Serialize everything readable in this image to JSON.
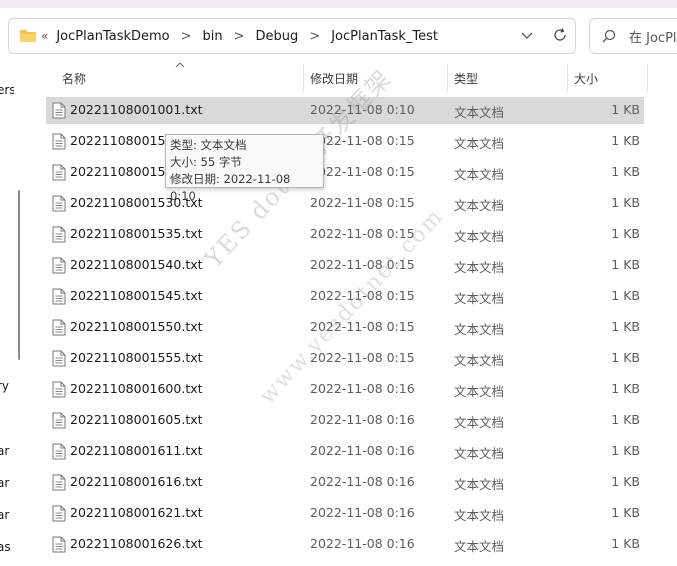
{
  "address": {
    "overflow_chevron": "«",
    "crumbs": [
      "JocPlanTaskDemo",
      "bin",
      "Debug",
      "JocPlanTask_Test"
    ],
    "separator": ">"
  },
  "search": {
    "placeholder": "在 JocPlan"
  },
  "navpane": {
    "fragments": [
      "ers",
      "ry",
      "ar",
      "ar",
      "ar",
      "as"
    ]
  },
  "columns": {
    "name": "名称",
    "date": "修改日期",
    "type": "类型",
    "size": "大小"
  },
  "files": [
    {
      "name": "20221108001001.txt",
      "date": "2022-11-08 0:10",
      "type": "文本文档",
      "size": "1 KB"
    },
    {
      "name": "20221108001520.txt",
      "date": "2022-11-08 0:15",
      "type": "文本文档",
      "size": "1 KB"
    },
    {
      "name": "20221108001525.txt",
      "date": "2022-11-08 0:15",
      "type": "文本文档",
      "size": "1 KB"
    },
    {
      "name": "20221108001530.txt",
      "date": "2022-11-08 0:15",
      "type": "文本文档",
      "size": "1 KB"
    },
    {
      "name": "20221108001535.txt",
      "date": "2022-11-08 0:15",
      "type": "文本文档",
      "size": "1 KB"
    },
    {
      "name": "20221108001540.txt",
      "date": "2022-11-08 0:15",
      "type": "文本文档",
      "size": "1 KB"
    },
    {
      "name": "20221108001545.txt",
      "date": "2022-11-08 0:15",
      "type": "文本文档",
      "size": "1 KB"
    },
    {
      "name": "20221108001550.txt",
      "date": "2022-11-08 0:15",
      "type": "文本文档",
      "size": "1 KB"
    },
    {
      "name": "20221108001555.txt",
      "date": "2022-11-08 0:15",
      "type": "文本文档",
      "size": "1 KB"
    },
    {
      "name": "20221108001600.txt",
      "date": "2022-11-08 0:16",
      "type": "文本文档",
      "size": "1 KB"
    },
    {
      "name": "20221108001605.txt",
      "date": "2022-11-08 0:16",
      "type": "文本文档",
      "size": "1 KB"
    },
    {
      "name": "20221108001611.txt",
      "date": "2022-11-08 0:16",
      "type": "文本文档",
      "size": "1 KB"
    },
    {
      "name": "20221108001616.txt",
      "date": "2022-11-08 0:16",
      "type": "文本文档",
      "size": "1 KB"
    },
    {
      "name": "20221108001621.txt",
      "date": "2022-11-08 0:16",
      "type": "文本文档",
      "size": "1 KB"
    },
    {
      "name": "20221108001626.txt",
      "date": "2022-11-08 0:16",
      "type": "文本文档",
      "size": "1 KB"
    }
  ],
  "tooltip": {
    "type_line": "类型: 文本文档",
    "size_line": "大小: 55 字节",
    "date_line": "修改日期: 2022-11-08 0:10"
  },
  "watermark": {
    "line1": "YES dotnet开发框架",
    "line2": "www.yesdotnet.com"
  },
  "colors": {
    "selected_row": "#d9d9d9",
    "folder": "#f2c14e"
  },
  "icons": {
    "folder": "folder-icon",
    "dropdown": "chevron-down-icon",
    "refresh": "refresh-icon",
    "search": "search-icon",
    "sort": "sort-up-icon",
    "file": "text-file-icon"
  }
}
